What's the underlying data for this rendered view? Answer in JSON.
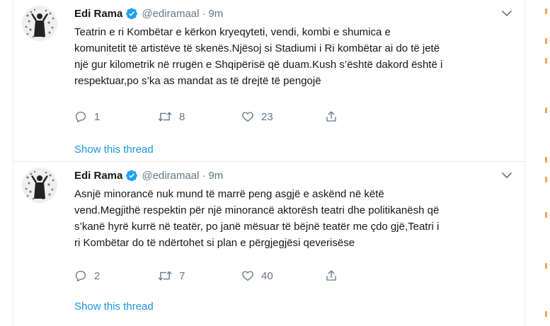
{
  "tweets": [
    {
      "author_name": "Edi Rama",
      "handle": "@ediramaal",
      "separator": "·",
      "time": "9m",
      "text_lines": [
        "Teatrin e ri Kombëtar e kërkon kryeqyteti, vendi, kombi e shumica e",
        "komunitetit të artistëve të skenës.Njësoj si Stadiumi i Ri kombëtar ai do të jetë",
        "një gur kilometrik në rrugën e Shqipërisë që duam.Kush s’është dakord është i",
        "respektuar,po s’ka as mandat as të drejtë të pengojë"
      ],
      "replies": "1",
      "retweets": "8",
      "likes": "23",
      "show_thread": "Show this thread"
    },
    {
      "author_name": "Edi Rama",
      "handle": "@ediramaal",
      "separator": "·",
      "time": "9m",
      "text_lines": [
        "Asnjë minorancë nuk mund të marrë peng asgjë e askënd në këtë",
        "vend.Megjithë respektin për një minorancë aktorësh teatri dhe politikanësh që",
        "s’kanë hyrë kurrë në teatër, po janë mësuar të bëjnë teatër me çdo gjë,Teatri i",
        "ri Kombëtar do të ndërtohet si plan e përgjegjësi qeverisëse"
      ],
      "replies": "2",
      "retweets": "7",
      "likes": "40",
      "show_thread": "Show this thread"
    }
  ],
  "icons": {
    "verified": "verified-badge-icon",
    "caret": "chevron-down-icon",
    "reply": "reply-icon",
    "retweet": "retweet-icon",
    "like": "heart-icon",
    "share": "share-icon"
  },
  "colors": {
    "text_primary": "#14171a",
    "text_secondary": "#657786",
    "link": "#1b95e0",
    "verified": "#1da1f2",
    "divider": "#e6ecf0",
    "edge_marks": "#f2a65a"
  }
}
